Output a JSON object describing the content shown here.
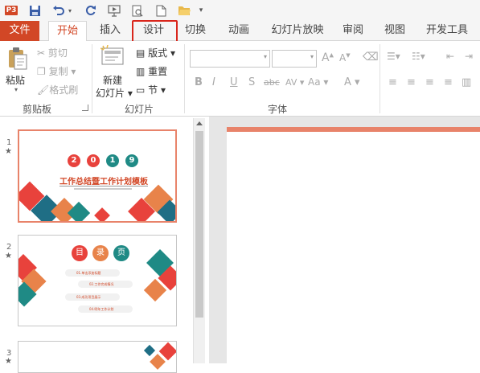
{
  "qat": {
    "app_icon_label": "P3",
    "icons": [
      "save-icon",
      "undo-icon",
      "redo-icon",
      "slideshow-icon",
      "print-preview-icon",
      "new-icon",
      "open-icon",
      "customize-icon"
    ]
  },
  "tabs": [
    {
      "label": "文件"
    },
    {
      "label": "开始"
    },
    {
      "label": "插入"
    },
    {
      "label": "设计"
    },
    {
      "label": "切换"
    },
    {
      "label": "动画"
    },
    {
      "label": "幻灯片放映"
    },
    {
      "label": "审阅"
    },
    {
      "label": "视图"
    },
    {
      "label": "开发工具"
    }
  ],
  "ribbon": {
    "clipboard": {
      "paste": "粘贴",
      "cut": "剪切",
      "copy": "复制",
      "format_painter": "格式刷",
      "group_label": "剪贴板"
    },
    "slides": {
      "new_slide_line1": "新建",
      "new_slide_line2": "幻灯片",
      "layout": "版式",
      "reset": "重置",
      "section": "节",
      "group_label": "幻灯片"
    },
    "font": {
      "font_name": "",
      "font_size": "",
      "bold": "B",
      "italic": "I",
      "underline": "U",
      "shadow": "S",
      "strike": "abc",
      "spacing": "AV",
      "case": "Aa",
      "color": "A",
      "grow": "A",
      "shrink": "A",
      "group_label": "字体"
    }
  },
  "slides": [
    {
      "number": "1",
      "digits": [
        "2",
        "0",
        "1",
        "9"
      ],
      "title": "工作总结暨工作计划模板"
    },
    {
      "number": "2",
      "heads": [
        "目",
        "录",
        "页"
      ],
      "items": [
        "01.单击添加标题",
        "02.工作完成情况",
        "03.成功项目展示",
        "04.明年工作计划"
      ]
    },
    {
      "number": "3"
    }
  ],
  "colors": {
    "accent": "#d24726",
    "highlight": "#d9261c",
    "teal": "#1f8a85",
    "slide_red": "#e8423c"
  }
}
